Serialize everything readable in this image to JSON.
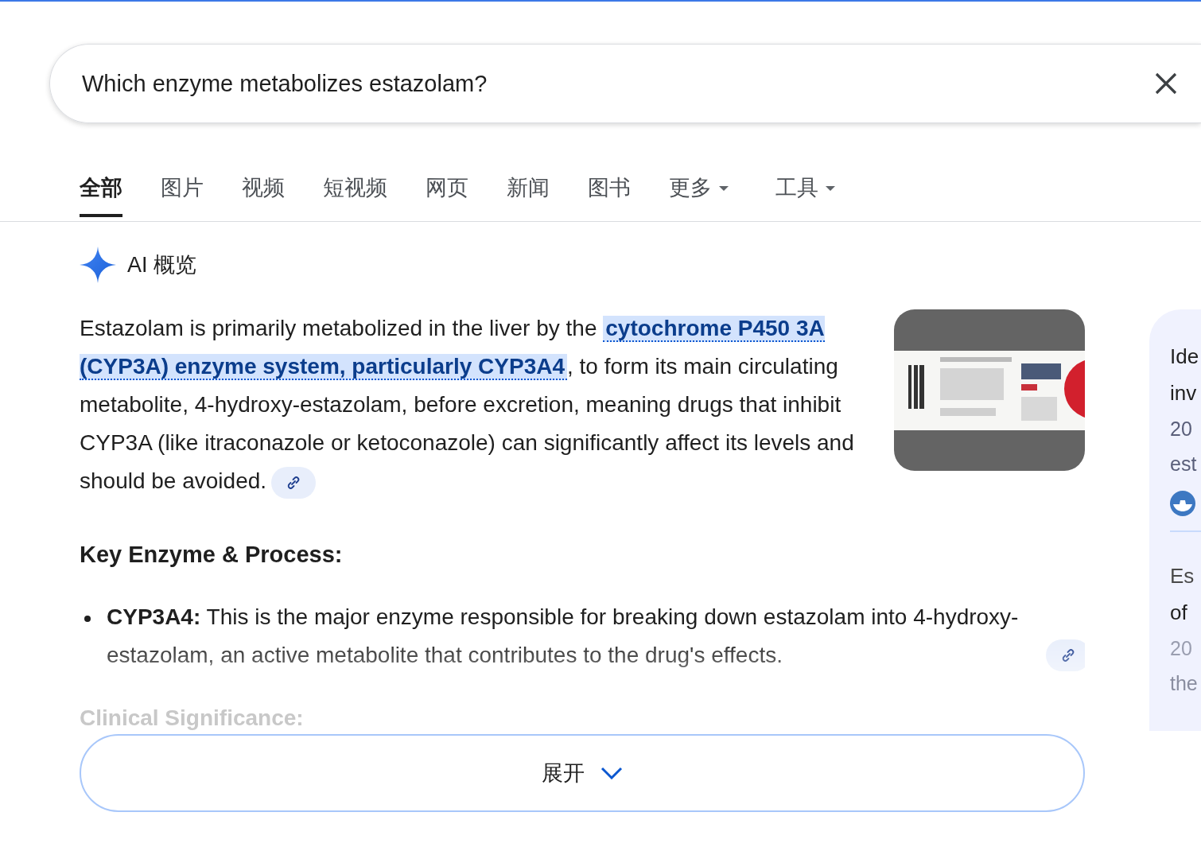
{
  "search": {
    "value": "Which enzyme metabolizes estazolam?"
  },
  "tabs": [
    {
      "label": "全部",
      "selected": true,
      "kind": "plain"
    },
    {
      "label": "图片",
      "selected": false,
      "kind": "plain"
    },
    {
      "label": "视频",
      "selected": false,
      "kind": "plain"
    },
    {
      "label": "短视频",
      "selected": false,
      "kind": "plain"
    },
    {
      "label": "网页",
      "selected": false,
      "kind": "plain"
    },
    {
      "label": "新闻",
      "selected": false,
      "kind": "plain"
    },
    {
      "label": "图书",
      "selected": false,
      "kind": "plain"
    },
    {
      "label": "更多",
      "selected": false,
      "kind": "menu"
    },
    {
      "label": "工具",
      "selected": false,
      "kind": "menu"
    }
  ],
  "ai_overview": {
    "title": "AI 概览",
    "summary": "Estazolam is primarily metabolized in the liver by the **cytochrome P450 3A (CYP3A) enzyme system, particularly CYP3A4**, to form its main circulating metabolite, 4-hydroxy-estazolam, before excretion, meaning drugs that inhibit CYP3A (like itraconazole or ketoconazole) can significantly affect its levels and should be avoided.",
    "image": {
      "kind": "picture"
    },
    "section_heading": "Key Enzyme & Process:",
    "bullets": [
      "**CYP3A4:** This is the major enzyme responsible for breaking down estazolam into 4-hydroxy-estazolam, an active metabolite that contributes to the drug's effects."
    ],
    "faded_heading": "Clinical Significance:",
    "expand_button": "展开"
  },
  "sources": [
    {
      "title_lines": [
        "Ide",
        "inv"
      ],
      "snippet_lines": [
        "20",
        "est"
      ],
      "has_favicon": true
    },
    {
      "title_lines": [
        "Es",
        "of"
      ],
      "snippet_lines": [
        "20",
        "the"
      ],
      "has_favicon": false
    }
  ]
}
